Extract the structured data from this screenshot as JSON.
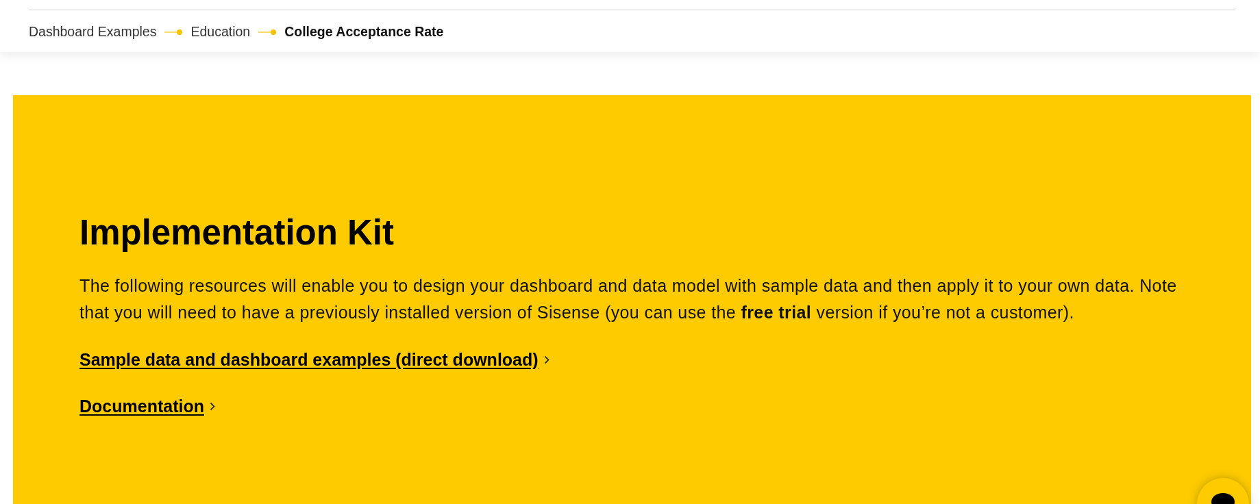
{
  "breadcrumb": [
    {
      "label": "Dashboard Examples",
      "current": false
    },
    {
      "label": "Education",
      "current": false
    },
    {
      "label": "College Acceptance Rate",
      "current": true
    }
  ],
  "kit": {
    "title": "Implementation Kit",
    "body": "The following resources will enable you to design your dashboard and data model with sample data and then apply it to your own data. Note that you will need to have a previously installed version of Sisense (you can use the **free trial** version if you’re not a customer).",
    "links": [
      {
        "label": "Sample data and dashboard examples (direct download)"
      },
      {
        "label": "Documentation"
      }
    ]
  }
}
